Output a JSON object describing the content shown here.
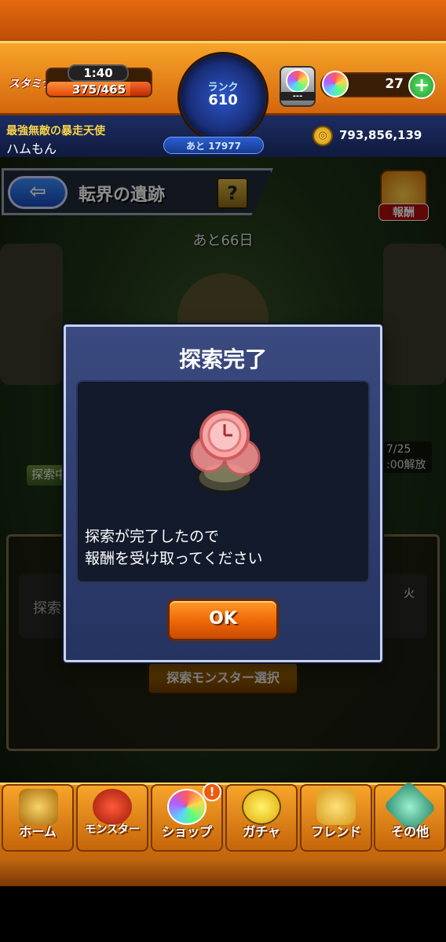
{
  "header": {
    "stamina_label": "スタミナ",
    "stamina_timer": "1:40",
    "stamina_value": "375/465",
    "stamina_fraction": 0.806,
    "rank_label": "ランク",
    "rank_value": "610",
    "rank_next": "あと 17977",
    "orb_device_text": "---",
    "orb_count": "27",
    "plus_symbol": "+",
    "player_title": "最強無敵の暴走天使",
    "player_name": "ハムもん",
    "coin_symbol": "◎",
    "coin_value": "793,856,139"
  },
  "quest": {
    "back_symbol": "⇦",
    "area_title": "転界の遺跡",
    "help_symbol": "?",
    "reward_label": "報酬",
    "days_left": "あと66日"
  },
  "background": {
    "side_label": "探索中",
    "unlock_line1": "7/25",
    "unlock_line2": ":00解放",
    "explore_text": "探索",
    "fire_text": "火",
    "select_button": "探索モンスター選択"
  },
  "modal": {
    "title": "探索完了",
    "message_line1": "探索が完了したので",
    "message_line2": "報酬を受け取ってください",
    "ok_label": "OK"
  },
  "nav": {
    "items": [
      {
        "label": "ホーム",
        "icon": "home-icon"
      },
      {
        "label": "モンスター",
        "icon": "monster-icon"
      },
      {
        "label": "ショップ",
        "icon": "shop-orb-icon"
      },
      {
        "label": "ガチャ",
        "icon": "gacha-egg-icon"
      },
      {
        "label": "フレンド",
        "icon": "friend-icon"
      },
      {
        "label": "その他",
        "icon": "other-icon"
      }
    ],
    "badge": "!"
  },
  "colors": {
    "accent_orange": "#f06a08",
    "header_navy": "#14214a",
    "title_yellow": "#f7d34a"
  }
}
